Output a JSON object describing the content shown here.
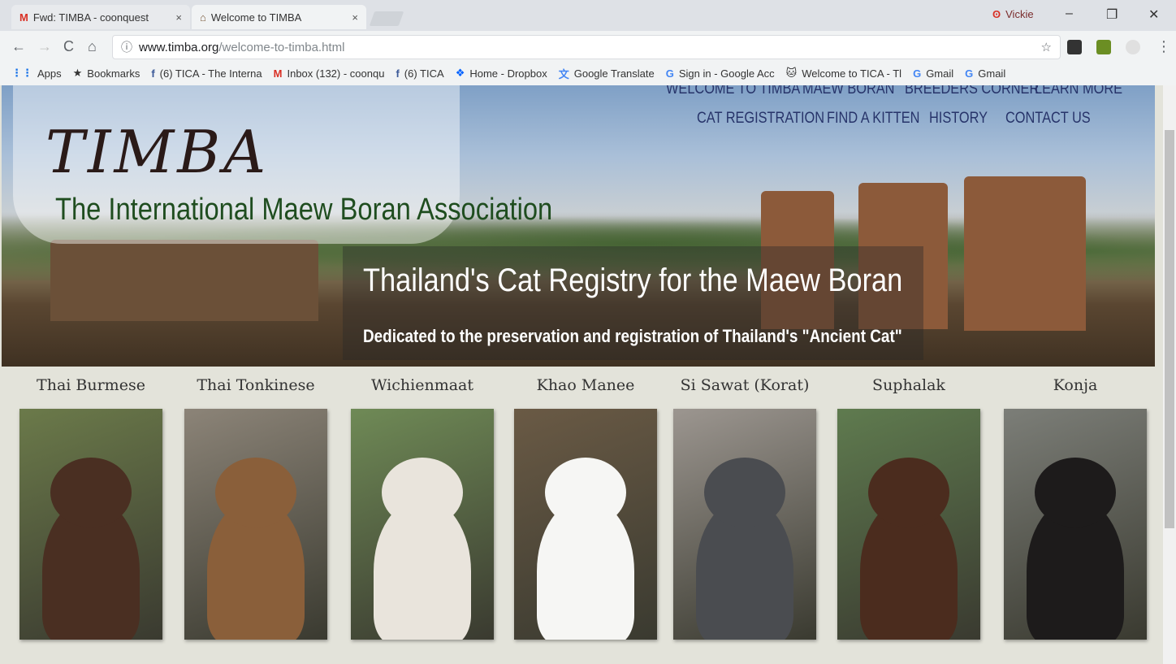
{
  "tabs": [
    {
      "title": "Fwd: TIMBA - coonquest",
      "icon": "gmail-icon",
      "close": "×"
    },
    {
      "title": "Welcome to TIMBA",
      "icon": "timba-favicon",
      "close": "×"
    }
  ],
  "profile_name": "Vickie",
  "window_controls": {
    "minimize": "–",
    "restore": "❐",
    "close": "✕"
  },
  "nav_buttons": {
    "back": "←",
    "forward": "→",
    "reload": "C",
    "home": "⌂"
  },
  "address": {
    "info": "ⓘ",
    "host": "www.timba.org",
    "path": "/welcome-to-timba.html",
    "star": "☆"
  },
  "bookmarks": [
    {
      "label": "Apps",
      "icon": "apps-grid-icon",
      "glyph": "⋮⋮",
      "color": "#1a73e8"
    },
    {
      "label": "Bookmarks",
      "icon": "star-icon",
      "glyph": "★",
      "color": "#333333"
    },
    {
      "label": "(6) TICA - The Interna",
      "icon": "facebook-icon",
      "glyph": "f",
      "color": "#3b5998"
    },
    {
      "label": "Inbox (132) - coonqu",
      "icon": "gmail-icon",
      "glyph": "M",
      "color": "#d93025"
    },
    {
      "label": "(6) TICA",
      "icon": "facebook-icon",
      "glyph": "f",
      "color": "#3b5998"
    },
    {
      "label": "Home - Dropbox",
      "icon": "dropbox-icon",
      "glyph": "❖",
      "color": "#0061ff"
    },
    {
      "label": "Google Translate",
      "icon": "translate-icon",
      "glyph": "文",
      "color": "#4285f4"
    },
    {
      "label": "Sign in - Google Acc",
      "icon": "google-icon",
      "glyph": "G",
      "color": "#4285f4"
    },
    {
      "label": "Welcome to TICA - Tl",
      "icon": "cat-icon",
      "glyph": "🐱",
      "color": "#333333"
    },
    {
      "label": "Gmail",
      "icon": "google-icon",
      "glyph": "G",
      "color": "#4285f4"
    },
    {
      "label": "Gmail",
      "icon": "google-icon",
      "glyph": "G",
      "color": "#4285f4"
    }
  ],
  "site": {
    "logo": "TIMBA",
    "association": "The International Maew Boran Association",
    "nav_top": [
      "WELCOME TO TIMBA",
      "MAEW BORAN",
      "BREEDERS CORNER",
      "LEARN MORE"
    ],
    "nav_bottom": [
      "CAT REGISTRATION",
      "FIND A KITTEN",
      "HISTORY",
      "CONTACT US"
    ],
    "tagline": "Thailand's Cat Registry for the Maew Boran",
    "subtitle": "Dedicated to the preservation and registration of Thailand's \"Ancient Cat\""
  },
  "breeds": [
    {
      "name": "Thai Burmese",
      "bg": "#6b7a4a",
      "cat": "#4a2f22"
    },
    {
      "name": "Thai Tonkinese",
      "bg": "#8c8478",
      "cat": "#8a5f3a"
    },
    {
      "name": "Wichienmaat",
      "bg": "#6f8a56",
      "cat": "#e9e4dc"
    },
    {
      "name": "Khao Manee",
      "bg": "#6a5a45",
      "cat": "#f6f6f4"
    },
    {
      "name": "Si Sawat (Korat)",
      "bg": "#9c9690",
      "cat": "#4a4c50"
    },
    {
      "name": "Suphalak",
      "bg": "#5f7b4f",
      "cat": "#4b2c1e"
    },
    {
      "name": "Konja",
      "bg": "#7c7e78",
      "cat": "#1d1b1b"
    }
  ]
}
